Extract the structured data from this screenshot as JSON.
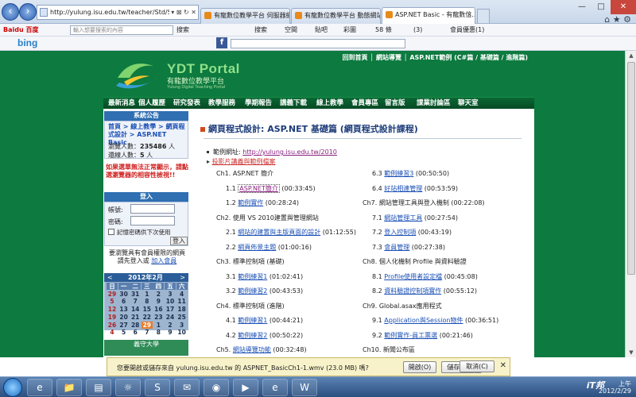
{
  "browser": {
    "url": "http://yulung.isu.edu.tw/teacher/Std/Std_ASPNET",
    "tabs": [
      {
        "title": "有龍數位教學平台 伺服器網站..."
      },
      {
        "title": "有龍數位教學平台 動態網站 基..."
      },
      {
        "title": "ASP.NET Basic - 有龍數位..."
      }
    ],
    "window_controls": {
      "minimize": "—",
      "maximize": "□",
      "close": "✕"
    },
    "toolbar1": {
      "baidu": "Baidu 百度",
      "search_placeholder": "輸入想要搜索的內容",
      "search_btn": "搜索",
      "items": [
        "搜索",
        "空間",
        "貼吧",
        "彩圖",
        "58 條",
        "(3)",
        "會員優惠(1)"
      ]
    },
    "toolbar2": {
      "bing": "bing"
    },
    "tools": {
      "home": "⌂",
      "fav": "★",
      "settings": "⚙"
    }
  },
  "site": {
    "top_links": "回到首頁 │ 網站導覽 │ ASP.NET範例 (C#篇 / 基礎篇 / 進階篇)",
    "logo": {
      "title": "YDT Portal",
      "subtitle": "有龍數位教學平台",
      "subtitle_en": "Yulung Digital Teaching Portal"
    },
    "menu": [
      "最新消息",
      "個人履歷",
      "研究發表",
      "教學服務",
      "學期報告",
      "講義下載",
      "線上教學",
      "會員專區",
      "留言版",
      "課業討論區",
      "聊天室"
    ]
  },
  "sidebar": {
    "bulletin_title": "系統公告",
    "breadcrumb": "首頁 > 線上教學 > 網頁程式設計 > ASP.NET Basic",
    "visits_label": "瀏覽人數：",
    "visits_value": "235486",
    "visits_unit": "人",
    "online_label": "還線人數：",
    "online_value": "5",
    "online_unit": "人",
    "notice": "如果選單無法正常顯示，請點選瀏覽器的相容性檢視!!",
    "login_title": "登入",
    "account_label": "帳號:",
    "password_label": "密碼:",
    "remember": "記憶密碼供下次使用",
    "login_btn": "登入",
    "member_note1": "要瀏覽具有會員權限的網頁",
    "member_note2": "請先登入或",
    "join_link": "加入會員",
    "calendar": {
      "prev": "<",
      "next": ">",
      "title": "2012年2月",
      "weekdays": [
        "日",
        "一",
        "二",
        "三",
        "四",
        "五",
        "六"
      ],
      "weeks": [
        [
          "29",
          "30",
          "31",
          "1",
          "2",
          "3",
          "4"
        ],
        [
          "5",
          "6",
          "7",
          "8",
          "9",
          "10",
          "11"
        ],
        [
          "12",
          "13",
          "14",
          "15",
          "16",
          "17",
          "18"
        ],
        [
          "19",
          "20",
          "21",
          "22",
          "23",
          "24",
          "25"
        ],
        [
          "26",
          "27",
          "28",
          "29",
          "1",
          "2",
          "3"
        ],
        [
          "4",
          "5",
          "6",
          "7",
          "8",
          "9",
          "10"
        ]
      ],
      "today": "29"
    },
    "school": "義守大學"
  },
  "content": {
    "title": "網頁程式設計: ASP.NET 基礎篇 (網頁程式設計課程)",
    "site_label": "範例網址:",
    "site_url": "http://yulung.isu.edu.tw/2010",
    "slides_link": "投影片講義與範例檔案",
    "left_chapters": [
      {
        "title": "Ch1. ASP.NET 簡介",
        "items": [
          {
            "num": "1.1",
            "name": "ASP.NET簡介",
            "time": "(00:33:45)"
          },
          {
            "num": "1.2",
            "name": "範例實作",
            "time": "(00:28:24)"
          }
        ]
      },
      {
        "title": "Ch2. 使用 VS 2010建置與管理網站",
        "items": [
          {
            "num": "2.1",
            "name": "網站的建置與主版頁面的設計",
            "time": "(01:12:55)"
          },
          {
            "num": "2.2",
            "name": "網頁佈景主題",
            "time": "(01:00:16)"
          }
        ]
      },
      {
        "title": "Ch3. 標準控制項 (基礎)",
        "items": [
          {
            "num": "3.1",
            "name": "範例練習1",
            "time": "(01:02:41)"
          },
          {
            "num": "3.2",
            "name": "範例練習2",
            "time": "(00:43:53)"
          }
        ]
      },
      {
        "title": "Ch4. 標準控制項 (進階)",
        "items": [
          {
            "num": "4.1",
            "name": "範例練習1",
            "time": "(00:44:21)"
          },
          {
            "num": "4.2",
            "name": "範例練習2",
            "time": "(00:50:22)"
          }
        ]
      },
      {
        "title": "Ch5. 網站導覽功能",
        "time": "(00:32:48)"
      }
    ],
    "right_chapters": [
      {
        "items": [
          {
            "num": "6.3",
            "name": "範例練習3",
            "time": "(00:50:50)"
          },
          {
            "num": "6.4",
            "name": "好站相連管理",
            "time": "(00:53:59)"
          }
        ]
      },
      {
        "title": "Ch7. 網站管理工具與登入機制",
        "time": "(00:22:08)",
        "items": [
          {
            "num": "7.1",
            "name": "網站管理工具",
            "time": "(00:27:54)"
          },
          {
            "num": "7.2",
            "name": "登入控制項",
            "time": "(00:43:19)"
          },
          {
            "num": "7.3",
            "name": "會員管理",
            "time": "(00:27:38)"
          }
        ]
      },
      {
        "title": "Ch8. 個人化機制 Profile 與資料驗證",
        "items": [
          {
            "num": "8.1",
            "name": "Profile使用者設定檔",
            "time": "(00:45:08)"
          },
          {
            "num": "8.2",
            "name": "資料驗證控制項實作",
            "time": "(00:55:12)"
          }
        ]
      },
      {
        "title": "Ch9. Global.asax應用程式",
        "items": [
          {
            "num": "9.1",
            "name": "Application與Session物件",
            "time": "(00:36:51)"
          },
          {
            "num": "9.2",
            "name": "範例實作-員工票選",
            "time": "(00:21:46)"
          }
        ]
      },
      {
        "title": "Ch10. 新聞公布區"
      }
    ]
  },
  "download": {
    "message": "您要開啟或儲存來自 yulung.isu.edu.tw 的 ASPNET_BasicCh1-1.wmv (23.0 MB) 嗎?",
    "open": "開啟(O)",
    "save": "儲存(S)",
    "save_arrow": "▼",
    "cancel": "取消(C)",
    "close": "✕"
  },
  "taskbar": {
    "apps": [
      "e",
      "📁",
      "▤",
      "☼",
      "S",
      "✉",
      "◉",
      "▶",
      "e",
      "W"
    ],
    "watermark": "iT邦",
    "time": "上午",
    "date": "2012/2/29"
  }
}
